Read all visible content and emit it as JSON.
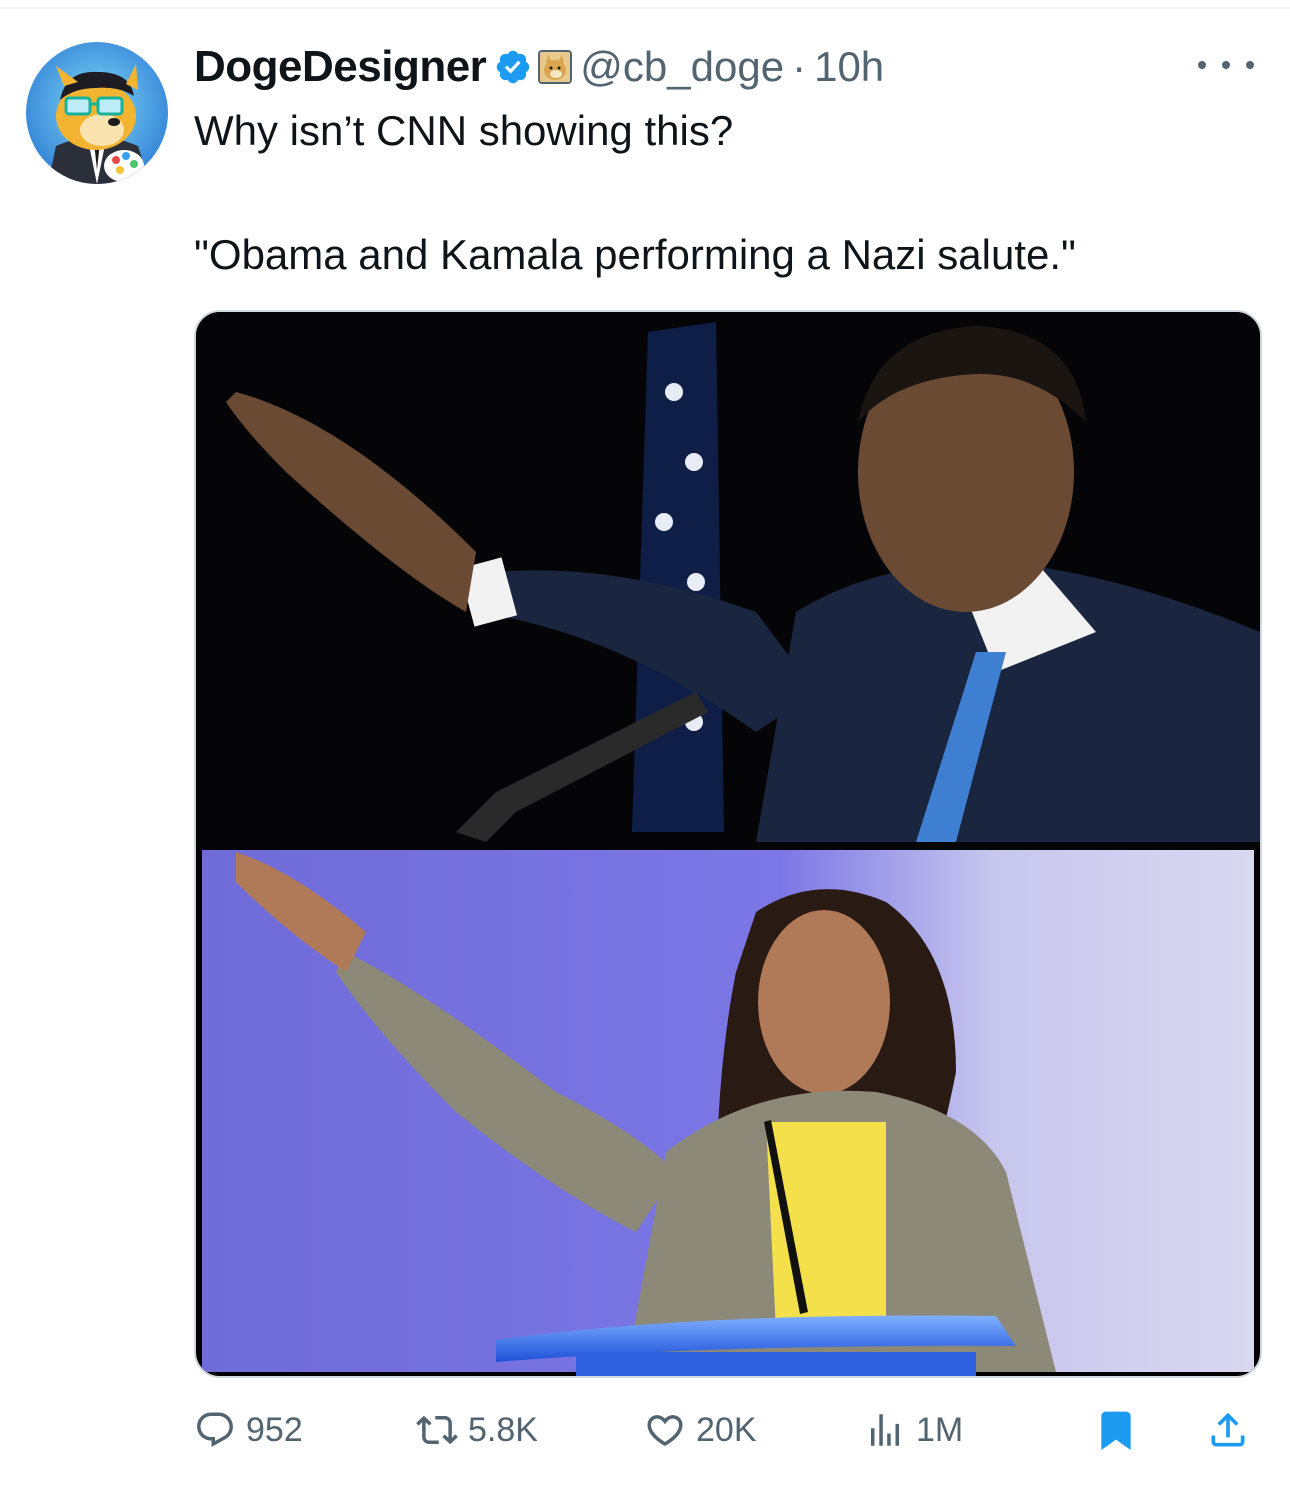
{
  "tweet": {
    "author": {
      "display_name": "DogeDesigner",
      "handle": "@cb_doge",
      "verified": true,
      "avatar_icon": "doge-avatar-icon",
      "affiliate_icon": "doge-badge-icon"
    },
    "separator": "·",
    "timestamp": "10h",
    "more_icon": "ellipsis-icon",
    "text_lines": [
      "Why isn’t CNN showing this?",
      "\"Obama and Kamala performing a Nazi salute.\""
    ],
    "media": {
      "type": "photo-collage",
      "panels": 2
    },
    "actions": {
      "replies": {
        "icon": "reply-icon",
        "count": "952"
      },
      "retweets": {
        "icon": "retweet-icon",
        "count": "5.8K"
      },
      "likes": {
        "icon": "heart-icon",
        "count": "20K"
      },
      "views": {
        "icon": "views-icon",
        "count": "1M"
      },
      "bookmark": {
        "icon": "bookmark-icon",
        "active": true
      },
      "share": {
        "icon": "share-icon"
      }
    }
  },
  "colors": {
    "text_primary": "#0f1419",
    "text_secondary": "#536471",
    "brand_blue": "#1d9bf0",
    "divider": "#eff3f4"
  }
}
